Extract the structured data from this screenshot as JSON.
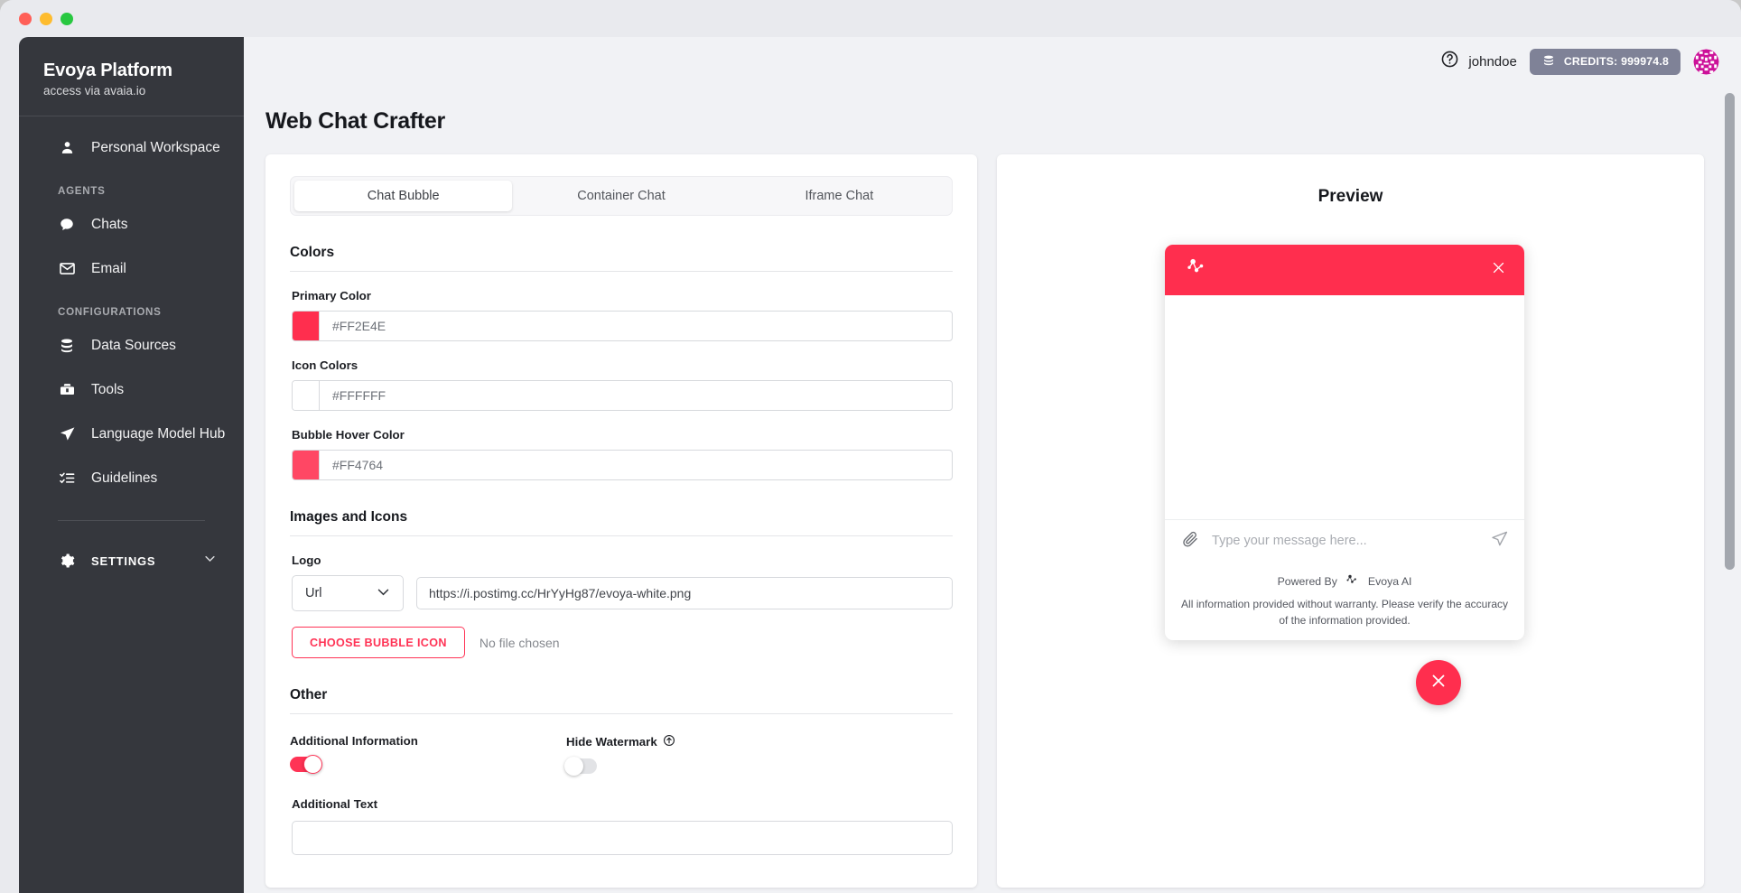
{
  "window": {
    "traffic_lights": [
      "close",
      "minimize",
      "maximize"
    ]
  },
  "sidebar": {
    "brand_title": "Evoya Platform",
    "brand_subtitle": "access via avaia.io",
    "workspace": {
      "label": "Personal Workspace",
      "icon": "person-icon"
    },
    "groups": [
      {
        "label": "AGENTS",
        "items": [
          {
            "label": "Chats",
            "icon": "chat-bubble-icon"
          },
          {
            "label": "Email",
            "icon": "envelope-icon"
          }
        ]
      },
      {
        "label": "CONFIGURATIONS",
        "items": [
          {
            "label": "Data Sources",
            "icon": "database-icon"
          },
          {
            "label": "Tools",
            "icon": "toolbox-icon"
          },
          {
            "label": "Language Model Hub",
            "icon": "send-paper-plane-icon"
          },
          {
            "label": "Guidelines",
            "icon": "list-checks-icon"
          }
        ]
      }
    ],
    "settings": {
      "label": "SETTINGS",
      "icon": "gear-icon",
      "chevron": "chevron-down-icon"
    }
  },
  "topbar": {
    "help_icon": "help-circle-icon",
    "username": "johndoe",
    "credits_icon": "coins-icon",
    "credits_label": "CREDITS: 999974.8",
    "avatar": "user-identicon-avatar"
  },
  "main": {
    "page_title": "Web Chat Crafter",
    "tabs": [
      {
        "label": "Chat Bubble",
        "active": true
      },
      {
        "label": "Container Chat",
        "active": false
      },
      {
        "label": "Iframe Chat",
        "active": false
      }
    ],
    "sections": {
      "colors": {
        "heading": "Colors",
        "fields": [
          {
            "label": "Primary Color",
            "value": "#FF2E4E",
            "swatch": "#ff2e4e"
          },
          {
            "label": "Icon Colors",
            "value": "#FFFFFF",
            "swatch": "#ffffff"
          },
          {
            "label": "Bubble Hover Color",
            "value": "#FF4764",
            "swatch": "#ff4764"
          }
        ]
      },
      "images": {
        "heading": "Images and Icons",
        "logo_label": "Logo",
        "source_select": "Url",
        "select_chevron": "chevron-down-icon",
        "logo_url": "https://i.postimg.cc/HrYyHg87/evoya-white.png",
        "choose_button": "CHOOSE BUBBLE ICON",
        "file_status": "No file chosen"
      },
      "other": {
        "heading": "Other",
        "additional_information_label": "Additional Information",
        "additional_information_on": true,
        "hide_watermark_label": "Hide Watermark",
        "hide_watermark_icon": "upgrade-circle-arrow-icon",
        "hide_watermark_on": false,
        "additional_text_label": "Additional Text",
        "additional_text_value": ""
      }
    }
  },
  "preview": {
    "title": "Preview",
    "widget": {
      "header_color": "#ff2e4e",
      "logo_icon": "evoya-network-logo-icon",
      "close_icon": "close-x-icon",
      "attachment_icon": "paperclip-icon",
      "input_placeholder": "Type your message here...",
      "send_icon": "send-icon",
      "powered_by_text": "Powered By",
      "powered_by_brand": "Evoya AI",
      "powered_by_icon": "evoya-network-logo-dark-icon",
      "disclaimer": "All information provided without warranty. Please verify the accuracy of the information provided."
    },
    "fab": {
      "icon": "close-x-icon",
      "color": "#ff2e4e"
    }
  },
  "scrollbar": {
    "name": "vertical-scrollbar"
  }
}
